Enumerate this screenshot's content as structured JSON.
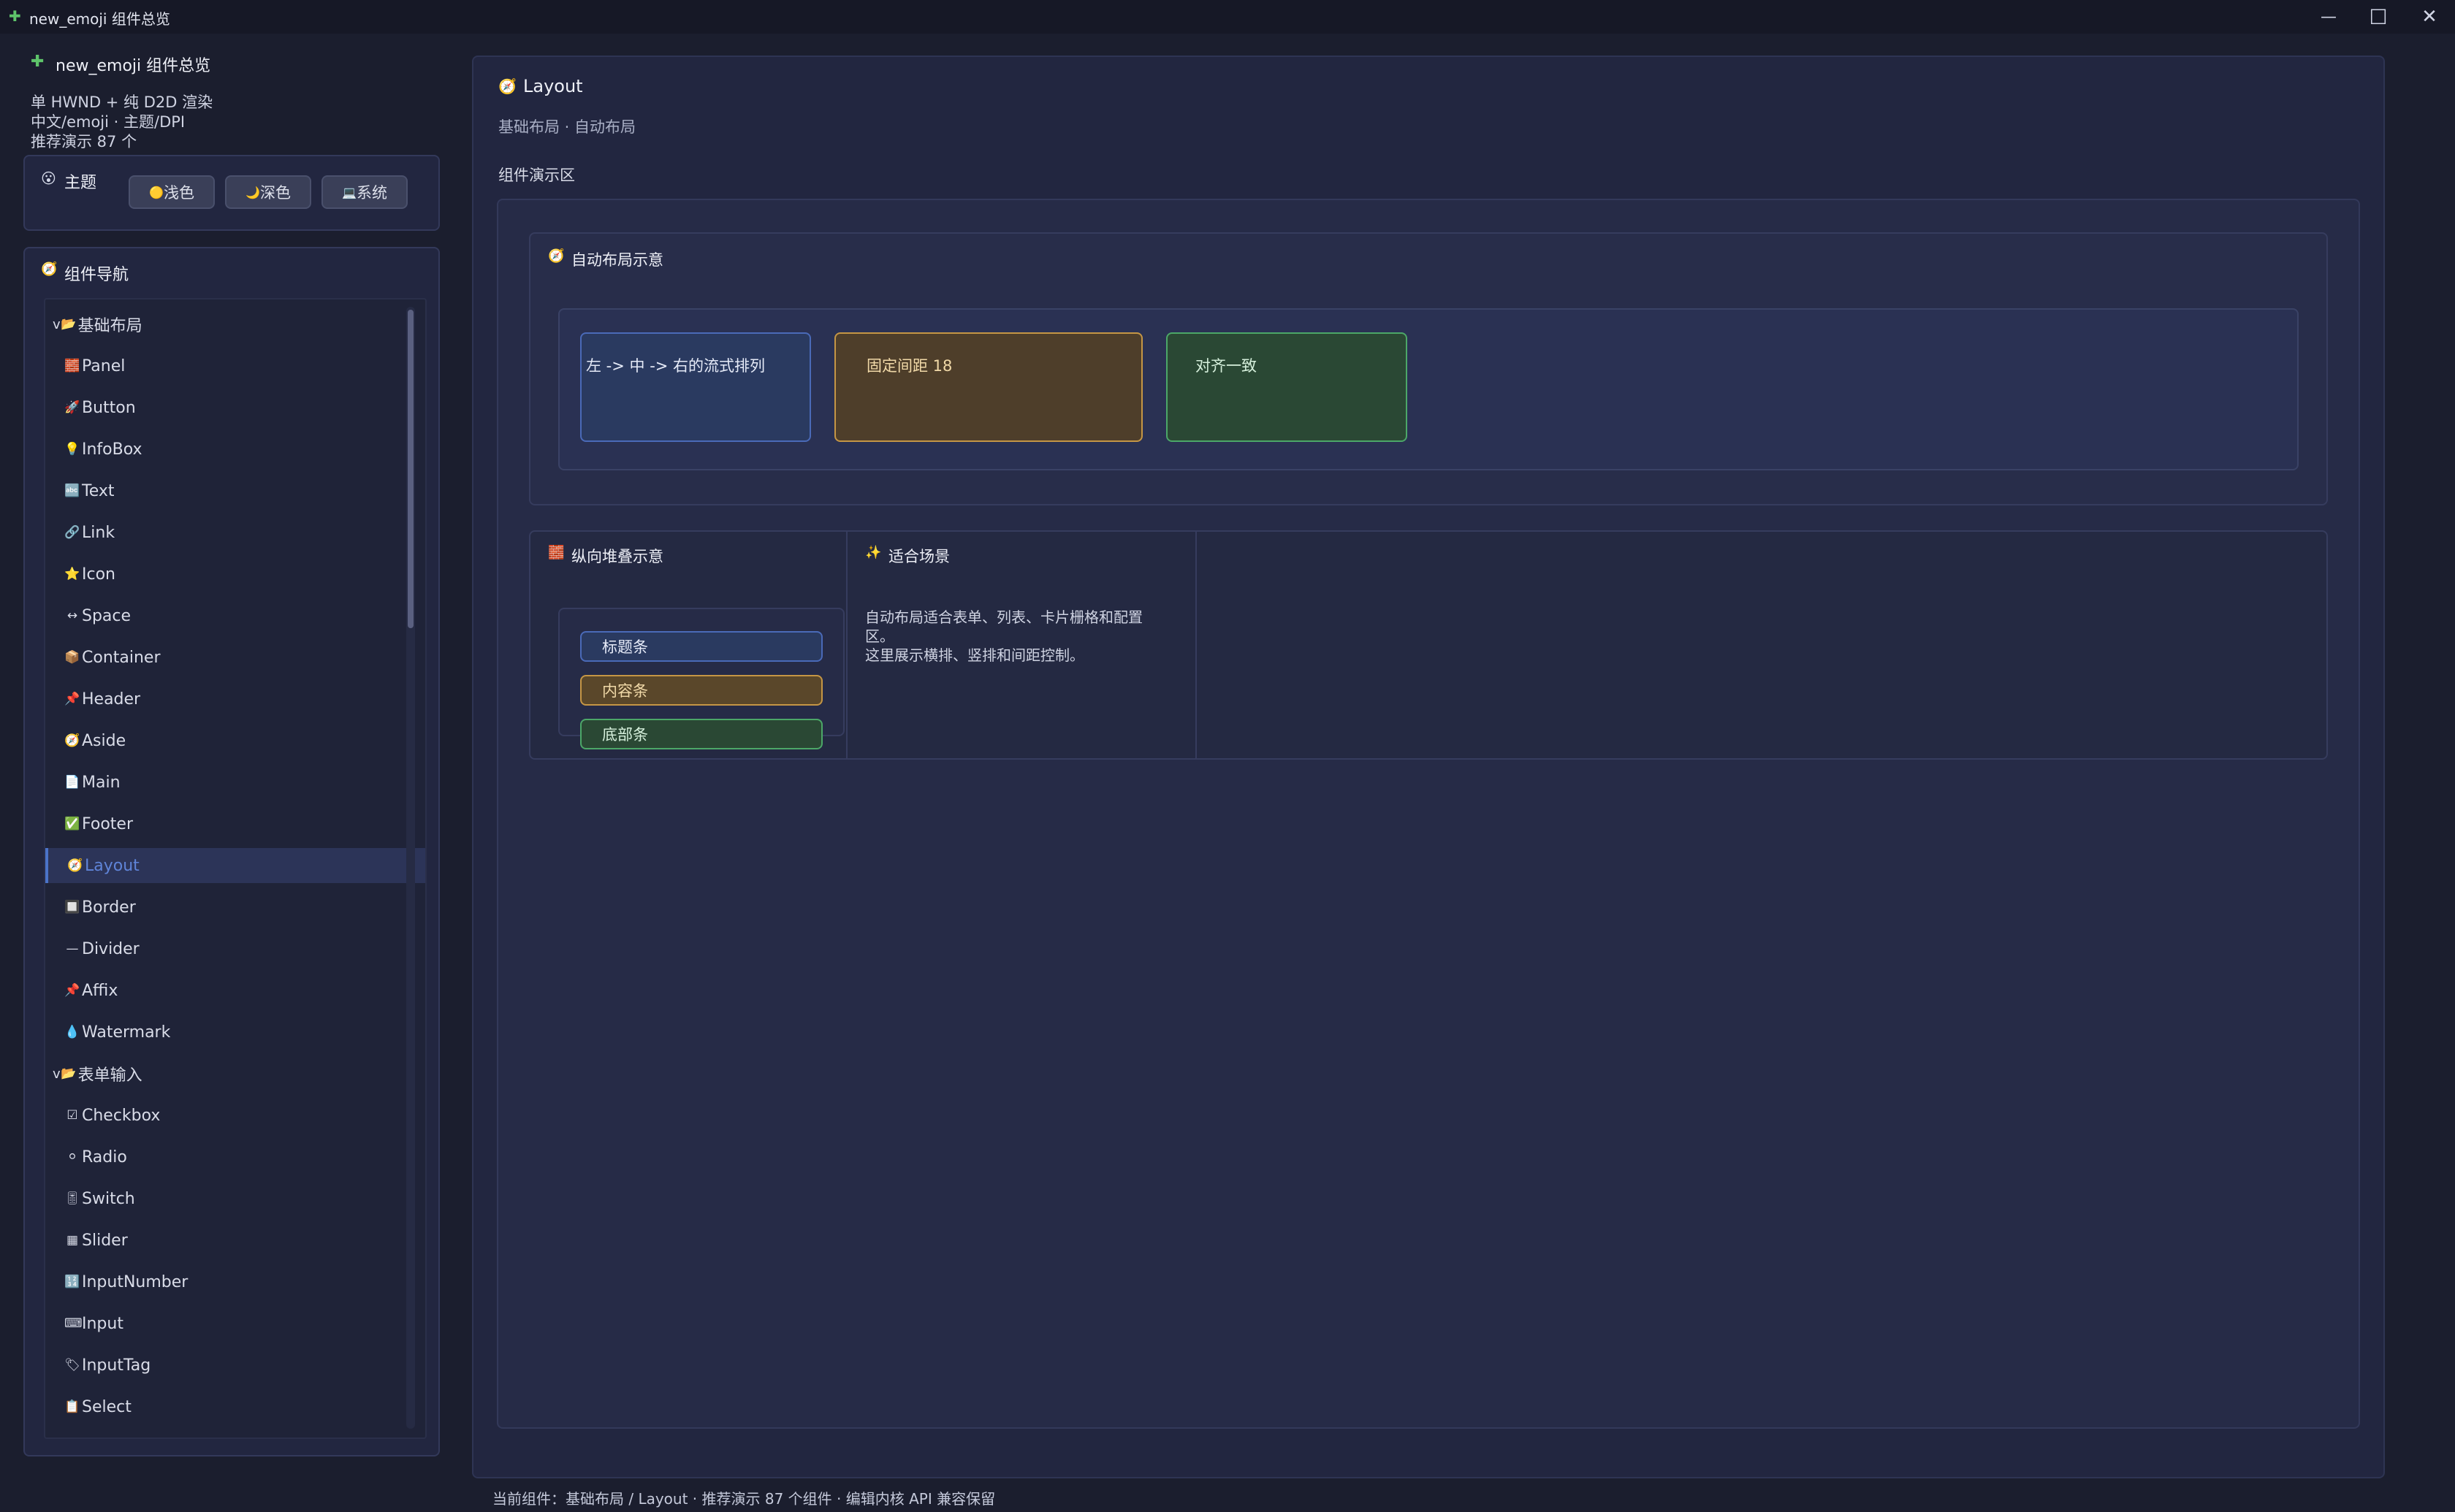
{
  "window": {
    "title": "new_emoji 组件总览",
    "icon": "puzzle-icon",
    "controls": {
      "minimize": "—",
      "maximize": "☐",
      "close": "✕"
    }
  },
  "sidebar": {
    "app_title": "new_emoji 组件总览",
    "lines": [
      "单 HWND + 纯 D2D 渲染",
      "中文/emoji · 主题/DPI",
      "推荐演示 87 个"
    ],
    "theme": {
      "label": "主题",
      "buttons": [
        {
          "icon": "🟡",
          "label": "浅色"
        },
        {
          "icon": "🌙",
          "label": "深色"
        },
        {
          "icon": "💻",
          "label": "系统"
        }
      ]
    },
    "nav": {
      "title": "组件导航",
      "items": [
        {
          "type": "group",
          "icon": "📂",
          "label": "基础布局",
          "prefix": "v"
        },
        {
          "type": "item",
          "icon": "🧱",
          "label": "Panel"
        },
        {
          "type": "item",
          "icon": "🚀",
          "label": "Button"
        },
        {
          "type": "item",
          "icon": "💡",
          "label": "InfoBox"
        },
        {
          "type": "item",
          "icon": "🔤",
          "label": "Text"
        },
        {
          "type": "item",
          "icon": "🔗",
          "label": "Link"
        },
        {
          "type": "item",
          "icon": "⭐",
          "label": "Icon"
        },
        {
          "type": "item",
          "icon": "↔",
          "label": "Space"
        },
        {
          "type": "item",
          "icon": "📦",
          "label": "Container"
        },
        {
          "type": "item",
          "icon": "📌",
          "label": "Header"
        },
        {
          "type": "item",
          "icon": "🧭",
          "label": "Aside"
        },
        {
          "type": "item",
          "icon": "📄",
          "label": "Main"
        },
        {
          "type": "item",
          "icon": "✅",
          "label": "Footer"
        },
        {
          "type": "item",
          "icon": "🧭",
          "label": "Layout",
          "selected": true
        },
        {
          "type": "item",
          "icon": "🔲",
          "label": "Border"
        },
        {
          "type": "item",
          "icon": "—",
          "label": "Divider"
        },
        {
          "type": "item",
          "icon": "📌",
          "label": "Affix"
        },
        {
          "type": "item",
          "icon": "💧",
          "label": "Watermark"
        },
        {
          "type": "group",
          "icon": "📂",
          "label": "表单输入",
          "prefix": "v"
        },
        {
          "type": "item",
          "icon": "☑",
          "label": "Checkbox"
        },
        {
          "type": "item",
          "icon": "⚪",
          "label": "Radio"
        },
        {
          "type": "item",
          "icon": "🎚",
          "label": "Switch"
        },
        {
          "type": "item",
          "icon": "▦",
          "label": "Slider"
        },
        {
          "type": "item",
          "icon": "🔢",
          "label": "InputNumber"
        },
        {
          "type": "item",
          "icon": "⌨",
          "label": "Input"
        },
        {
          "type": "item",
          "icon": "🏷",
          "label": "InputTag"
        },
        {
          "type": "item",
          "icon": "📋",
          "label": "Select"
        }
      ]
    }
  },
  "main": {
    "title": "Layout",
    "subtitle": "基础布局 · 自动布局",
    "demo_label": "组件演示区",
    "auto_layout": {
      "title": "自动布局示意",
      "items": [
        "左 -> 中 -> 右的流式排列",
        "固定间距 18",
        "对齐一致"
      ]
    },
    "stack": {
      "title": "纵向堆叠示意",
      "bars": [
        "标题条",
        "内容条",
        "底部条"
      ]
    },
    "scene": {
      "title": "适合场景",
      "text_line1": "自动布局适合表单、列表、卡片栅格和配置区。",
      "text_line2": "这里展示横排、竖排和间距控制。"
    }
  },
  "status": "当前组件：基础布局 / Layout · 推荐演示 87 个组件 · 编辑内核 API 兼容保留"
}
